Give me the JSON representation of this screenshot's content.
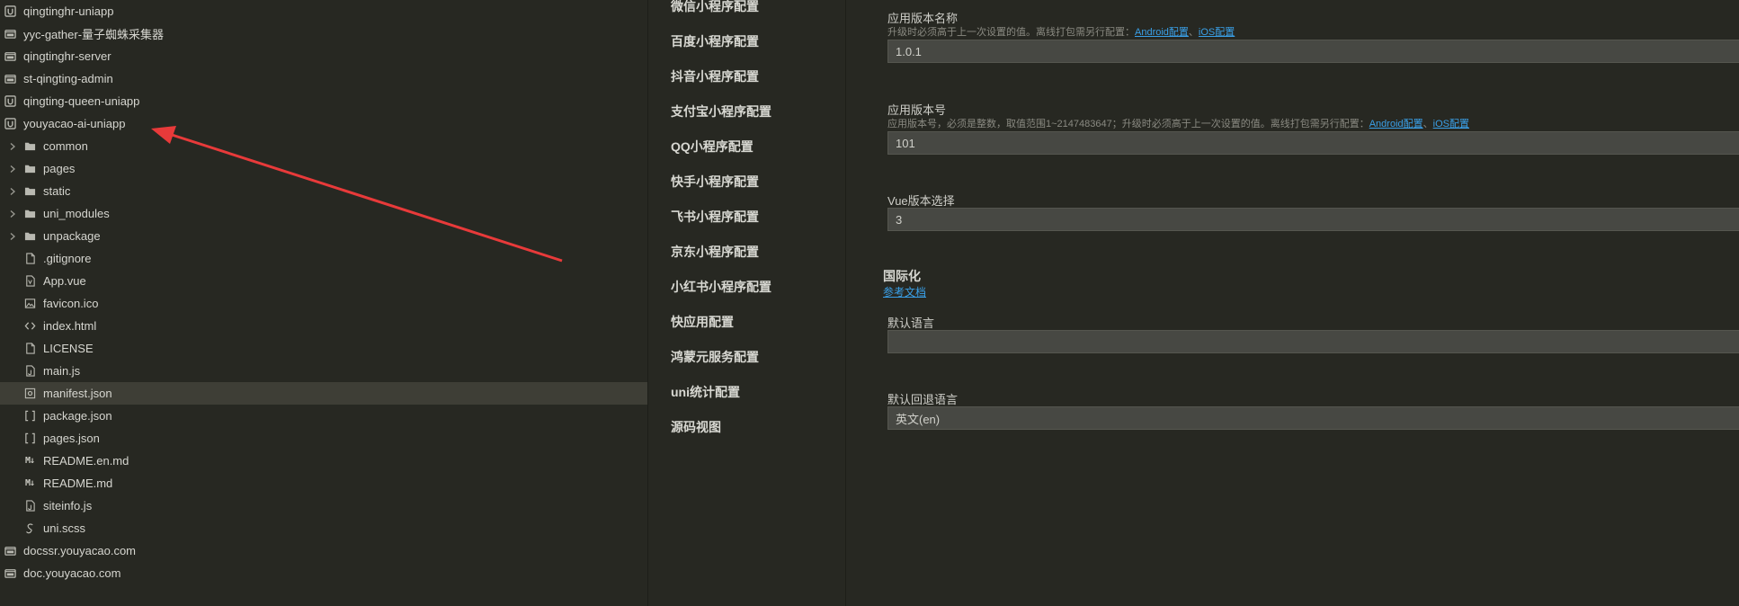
{
  "tree": {
    "items": [
      {
        "label": "qingtinghr-uniapp",
        "icon": "uniapp-project-icon"
      },
      {
        "label": "yyc-gather-量子蜘蛛采集器",
        "icon": "project-folder-icon"
      },
      {
        "label": "qingtinghr-server",
        "icon": "project-folder-icon"
      },
      {
        "label": "st-qingting-admin",
        "icon": "project-folder-icon"
      },
      {
        "label": "qingting-queen-uniapp",
        "icon": "uniapp-project-icon"
      },
      {
        "label": "youyacao-ai-uniapp",
        "icon": "uniapp-project-icon"
      },
      {
        "label": "common",
        "icon": "folder-icon"
      },
      {
        "label": "pages",
        "icon": "folder-icon"
      },
      {
        "label": "static",
        "icon": "folder-icon"
      },
      {
        "label": "uni_modules",
        "icon": "folder-icon"
      },
      {
        "label": "unpackage",
        "icon": "folder-icon"
      },
      {
        "label": ".gitignore",
        "icon": "file-icon"
      },
      {
        "label": "App.vue",
        "icon": "vue-file-icon"
      },
      {
        "label": "favicon.ico",
        "icon": "image-file-icon"
      },
      {
        "label": "index.html",
        "icon": "html-file-icon"
      },
      {
        "label": "LICENSE",
        "icon": "file-icon"
      },
      {
        "label": "main.js",
        "icon": "js-file-icon"
      },
      {
        "label": "manifest.json",
        "icon": "manifest-file-icon"
      },
      {
        "label": "package.json",
        "icon": "json-file-icon"
      },
      {
        "label": "pages.json",
        "icon": "json-file-icon"
      },
      {
        "label": "README.en.md",
        "icon": "markdown-file-icon"
      },
      {
        "label": "README.md",
        "icon": "markdown-file-icon"
      },
      {
        "label": "siteinfo.js",
        "icon": "js-file-icon"
      },
      {
        "label": "uni.scss",
        "icon": "scss-file-icon"
      },
      {
        "label": "docssr.youyacao.com",
        "icon": "project-folder-icon"
      },
      {
        "label": "doc.youyacao.com",
        "icon": "project-folder-icon"
      }
    ],
    "selected": "manifest.json"
  },
  "nav": {
    "items": [
      "微信小程序配置",
      "百度小程序配置",
      "抖音小程序配置",
      "支付宝小程序配置",
      "QQ小程序配置",
      "快手小程序配置",
      "飞书小程序配置",
      "京东小程序配置",
      "小红书小程序配置",
      "快应用配置",
      "鸿蒙元服务配置",
      "uni统计配置",
      "源码视图"
    ]
  },
  "form": {
    "version_name": {
      "label": "应用版本名称",
      "hint": "升级时必须高于上一次设置的值。离线打包需另行配置：",
      "link_android": "Android配置",
      "sep": "、",
      "link_ios": "iOS配置",
      "value": "1.0.1"
    },
    "version_code": {
      "label": "应用版本号",
      "hint": "应用版本号，必须是整数，取值范围1~2147483647；升级时必须高于上一次设置的值。离线打包需另行配置：",
      "link_android": "Android配置",
      "sep": "、",
      "link_ios": "iOS配置",
      "value": "101"
    },
    "vue_version": {
      "label": "Vue版本选择",
      "value": "3"
    },
    "i18n": {
      "title": "国际化",
      "link": "参考文档",
      "default_lang_label": "默认语言",
      "default_lang_value": "",
      "fallback_lang_label": "默认回退语言",
      "fallback_lang_value": "英文(en)"
    }
  },
  "colors": {
    "background": "#272822",
    "selected_row": "#3e3e36",
    "input_bg": "#474843",
    "link": "#3aa0e8",
    "annotation_arrow": "#e83a3a"
  }
}
